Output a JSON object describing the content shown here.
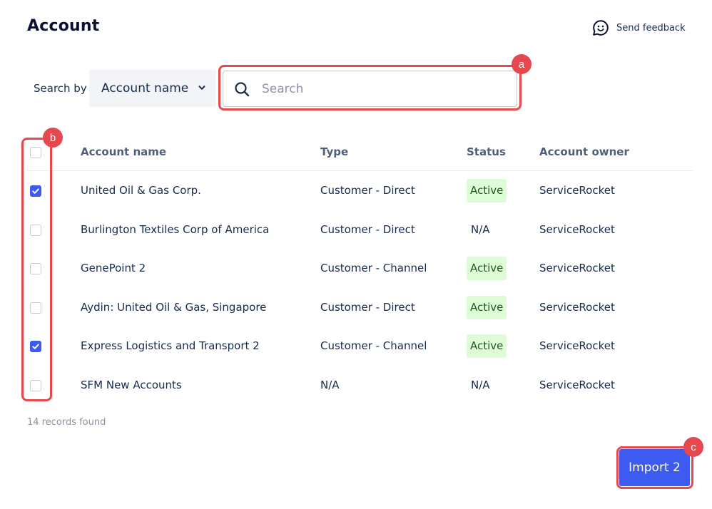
{
  "header": {
    "title": "Account",
    "feedback_label": "Send feedback",
    "feedback_icon": "smiley-chat-icon"
  },
  "search": {
    "by_label": "Search by",
    "field_value": "Account name",
    "placeholder": "Search",
    "value": ""
  },
  "table": {
    "columns": [
      "Account name",
      "Type",
      "Status",
      "Account owner"
    ],
    "rows": [
      {
        "name": "United Oil & Gas Corp.",
        "type": "Customer - Direct",
        "status": "Active",
        "owner": "ServiceRocket",
        "checked": true
      },
      {
        "name": "Burlington Textiles Corp of America",
        "type": "Customer - Direct",
        "status": "N/A",
        "owner": "ServiceRocket",
        "checked": false
      },
      {
        "name": "GenePoint 2",
        "type": "Customer - Channel",
        "status": "Active",
        "owner": "ServiceRocket",
        "checked": false
      },
      {
        "name": "Aydin: United Oil & Gas, Singapore",
        "type": "Customer - Direct",
        "status": "Active",
        "owner": "ServiceRocket",
        "checked": false
      },
      {
        "name": "Express Logistics and Transport 2",
        "type": "Customer - Channel",
        "status": "Active",
        "owner": "ServiceRocket",
        "checked": true
      },
      {
        "name": "SFM New Accounts",
        "type": "N/A",
        "status": "N/A",
        "owner": "ServiceRocket",
        "checked": false
      }
    ],
    "records_found": "14 records found"
  },
  "actions": {
    "import_label": "Import 2"
  },
  "annotations": {
    "a": "a",
    "b": "b",
    "c": "c"
  },
  "colors": {
    "accent": "#3d5bf0",
    "highlight": "#e5484d",
    "active_bg": "#dffcd9"
  }
}
